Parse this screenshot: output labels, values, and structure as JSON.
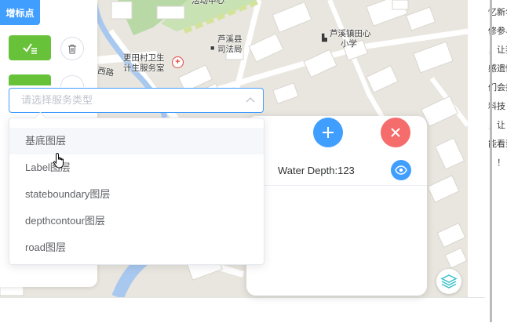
{
  "map": {
    "labels": {
      "top": "活动中心",
      "court1": "芦溪县",
      "court2": "司法局",
      "school1": "芦溪镇田心",
      "school2": "小学",
      "clinic1": "更田村卫生",
      "clinic2": "计生服务室",
      "road": "西路"
    }
  },
  "toolbar": {
    "add_marker_label": "增标点"
  },
  "select": {
    "placeholder": "请选择服务类型",
    "options": [
      "基底图层",
      "Label图层",
      "stateboundary图层",
      "depthcontour图层",
      "road图层"
    ]
  },
  "layer_panel": {
    "row_text": "Water Depth:123"
  },
  "right_strip": [
    "忆新年",
    "修参与",
    "，让我",
    "感遗憾",
    "们会把",
    "料技",
    "，让",
    "能看到",
    "！！"
  ],
  "colors": {
    "primary": "#409eff",
    "success": "#67c23a",
    "danger": "#f56c6c",
    "layers_icon": "#3cc1c9"
  }
}
